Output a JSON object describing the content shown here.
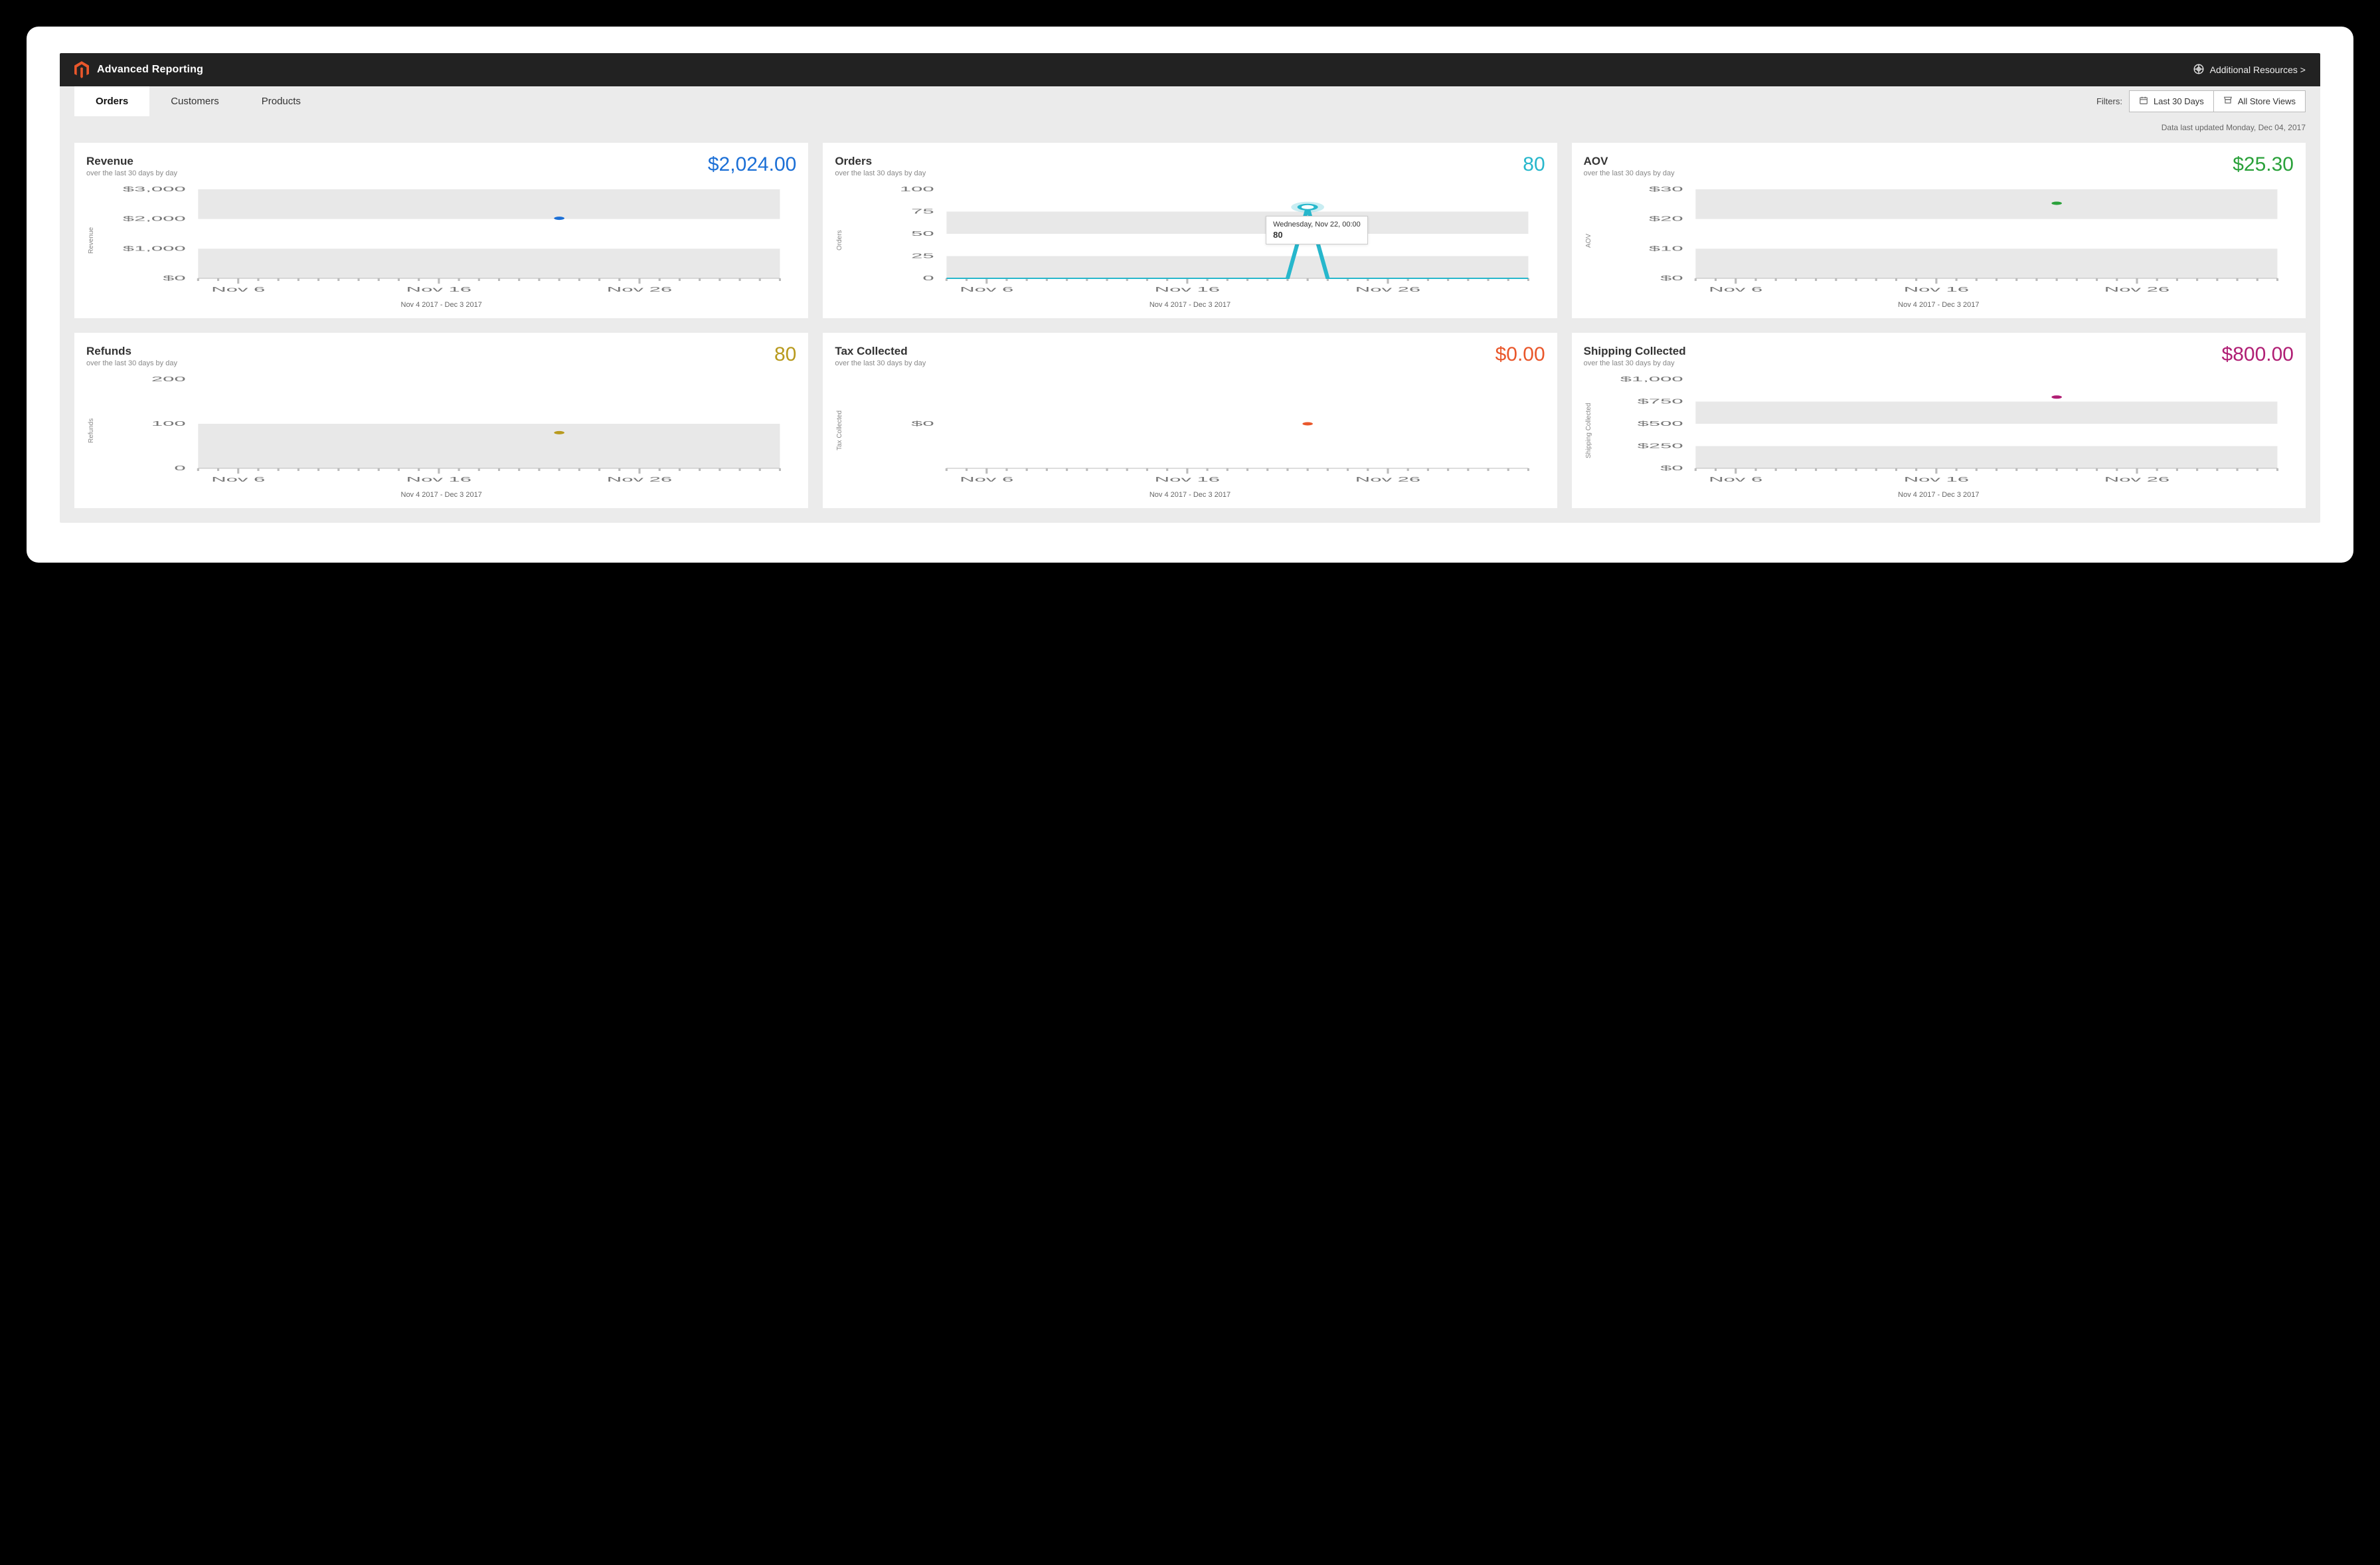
{
  "header": {
    "title": "Advanced Reporting",
    "resources_label": "Additional Resources >"
  },
  "tabs": [
    {
      "label": "Orders",
      "active": true
    },
    {
      "label": "Customers",
      "active": false
    },
    {
      "label": "Products",
      "active": false
    }
  ],
  "filters": {
    "label": "Filters:",
    "range": "Last 30 Days",
    "scope": "All Store Views"
  },
  "meta": {
    "last_updated": "Data last updated Monday, Dec 04, 2017"
  },
  "range_caption": "Nov 4 2017 - Dec 3 2017",
  "subheading": "over the last 30 days by day",
  "xticks": [
    "Nov 6",
    "Nov 16",
    "Nov 26"
  ],
  "cards": [
    {
      "id": "revenue",
      "title": "Revenue",
      "value": "$2,024.00",
      "color": "#1b6fd6",
      "ylabel": "Revenue",
      "yticks": [
        "$0",
        "$1,000",
        "$2,000",
        "$3,000"
      ],
      "ymax": 3000
    },
    {
      "id": "orders",
      "title": "Orders",
      "value": "80",
      "color": "#27b7cc",
      "ylabel": "Orders",
      "yticks": [
        "0",
        "25",
        "50",
        "75",
        "100"
      ],
      "ymax": 100,
      "tooltip": {
        "label": "Wednesday, Nov 22, 00:00",
        "value": "80"
      }
    },
    {
      "id": "aov",
      "title": "AOV",
      "value": "$25.30",
      "color": "#2aa13a",
      "ylabel": "AOV",
      "yticks": [
        "$0",
        "$10",
        "$20",
        "$30"
      ],
      "ymax": 30
    },
    {
      "id": "refunds",
      "title": "Refunds",
      "value": "80",
      "color": "#b89a1e",
      "ylabel": "Refunds",
      "yticks": [
        "0",
        "100",
        "200"
      ],
      "ymax": 200
    },
    {
      "id": "tax",
      "title": "Tax Collected",
      "value": "$0.00",
      "color": "#e9572b",
      "ylabel": "Tax Collected",
      "yticks": [
        "$0"
      ],
      "ymax": 0
    },
    {
      "id": "shipping",
      "title": "Shipping Collected",
      "value": "$800.00",
      "color": "#b01e74",
      "ylabel": "Shipping Collected",
      "yticks": [
        "$0",
        "$250",
        "$500",
        "$750",
        "$1,000"
      ],
      "ymax": 1000
    }
  ],
  "chart_data": [
    {
      "id": "revenue",
      "type": "line",
      "title": "Revenue",
      "ylabel": "Revenue",
      "ylim": [
        0,
        3000
      ],
      "x_dates_range": "Nov 4 2017 - Dec 3 2017",
      "series": [
        {
          "name": "Revenue",
          "points": [
            {
              "date": "Nov 22 2017",
              "value": 2024
            }
          ]
        }
      ],
      "baseline": 0
    },
    {
      "id": "orders",
      "type": "line",
      "title": "Orders",
      "ylabel": "Orders",
      "ylim": [
        0,
        100
      ],
      "x_dates_range": "Nov 4 2017 - Dec 3 2017",
      "series": [
        {
          "name": "Orders",
          "points": [
            {
              "date": "Nov 22 2017",
              "value": 80
            }
          ]
        }
      ],
      "baseline": 0
    },
    {
      "id": "aov",
      "type": "line",
      "title": "AOV",
      "ylabel": "AOV",
      "ylim": [
        0,
        30
      ],
      "x_dates_range": "Nov 4 2017 - Dec 3 2017",
      "series": [
        {
          "name": "AOV",
          "points": [
            {
              "date": "Nov 22 2017",
              "value": 25.3
            }
          ]
        }
      ],
      "baseline": 0
    },
    {
      "id": "refunds",
      "type": "line",
      "title": "Refunds",
      "ylabel": "Refunds",
      "ylim": [
        0,
        200
      ],
      "x_dates_range": "Nov 4 2017 - Dec 3 2017",
      "series": [
        {
          "name": "Refunds",
          "points": [
            {
              "date": "Nov 22 2017",
              "value": 80
            }
          ]
        }
      ],
      "baseline": 0
    },
    {
      "id": "tax",
      "type": "line",
      "title": "Tax Collected",
      "ylabel": "Tax Collected",
      "ylim": [
        0,
        0
      ],
      "x_dates_range": "Nov 4 2017 - Dec 3 2017",
      "series": [
        {
          "name": "Tax Collected",
          "points": [
            {
              "date": "Nov 22 2017",
              "value": 0
            }
          ]
        }
      ],
      "baseline": 0
    },
    {
      "id": "shipping",
      "type": "line",
      "title": "Shipping Collected",
      "ylabel": "Shipping Collected",
      "ylim": [
        0,
        1000
      ],
      "x_dates_range": "Nov 4 2017 - Dec 3 2017",
      "series": [
        {
          "name": "Shipping Collected",
          "points": [
            {
              "date": "Nov 22 2017",
              "value": 800
            }
          ]
        }
      ],
      "baseline": 0
    }
  ]
}
